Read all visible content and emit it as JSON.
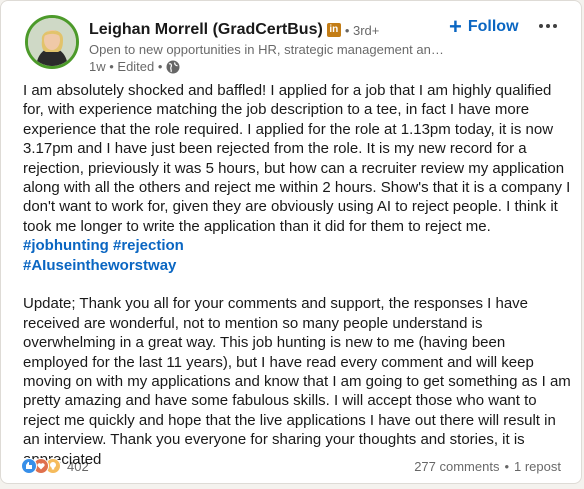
{
  "post": {
    "author": {
      "name": "Leighan Morrell (GradCertBus)",
      "badge": "in",
      "degree": "• 3rd+",
      "headline": "Open to new opportunities in HR, strategic management and le...",
      "time": "1w • Edited •"
    },
    "follow_label": "Follow",
    "paragraph1": "I am absolutely shocked and baffled! I applied for a job that I am highly qualified for, with experience matching the job description to a tee, in fact I have more experience that the role required. I applied for the role at 1.13pm today, it is now 3.17pm and I have just been rejected from the role. It is my new record for a rejection, prieviously it was 5 hours, but how can a recruiter review my application along with all the others and reject me within 2 hours. Show's that it is a company I don't want to work for, given they are obviously using AI to reject people. I think it took me longer to write the application than it did for them to reject me.",
    "hashtags": [
      "#jobhunting",
      "#rejection",
      "#AIuseintheworstway"
    ],
    "paragraph2": "Update; Thank you all for your comments and support, the responses I have received are wonderful, not to mention so many people understand is overwhelming in a great way. This job hunting is new to me (having been employed for the last 11 years), but I have read every comment and will keep moving on with my applications and know that I am going to get something as I am pretty amazing and have some fabulous skills. I will accept those who want to reject me quickly and hope that the live applications I have out there will result in an interview. Thank you everyone for sharing your thoughts and stories, it is appreciated",
    "reactions_count": "402",
    "comments": "277 comments",
    "separator": "•",
    "reposts": "1 repost",
    "icons": [
      "like-icon",
      "love-icon",
      "insightful-icon",
      "globe-icon",
      "more-icon",
      "plus-icon"
    ],
    "colors": {
      "link": "#0a66c2",
      "avatar_ring": "#4c9a2a",
      "badge": "#c37d16"
    }
  }
}
